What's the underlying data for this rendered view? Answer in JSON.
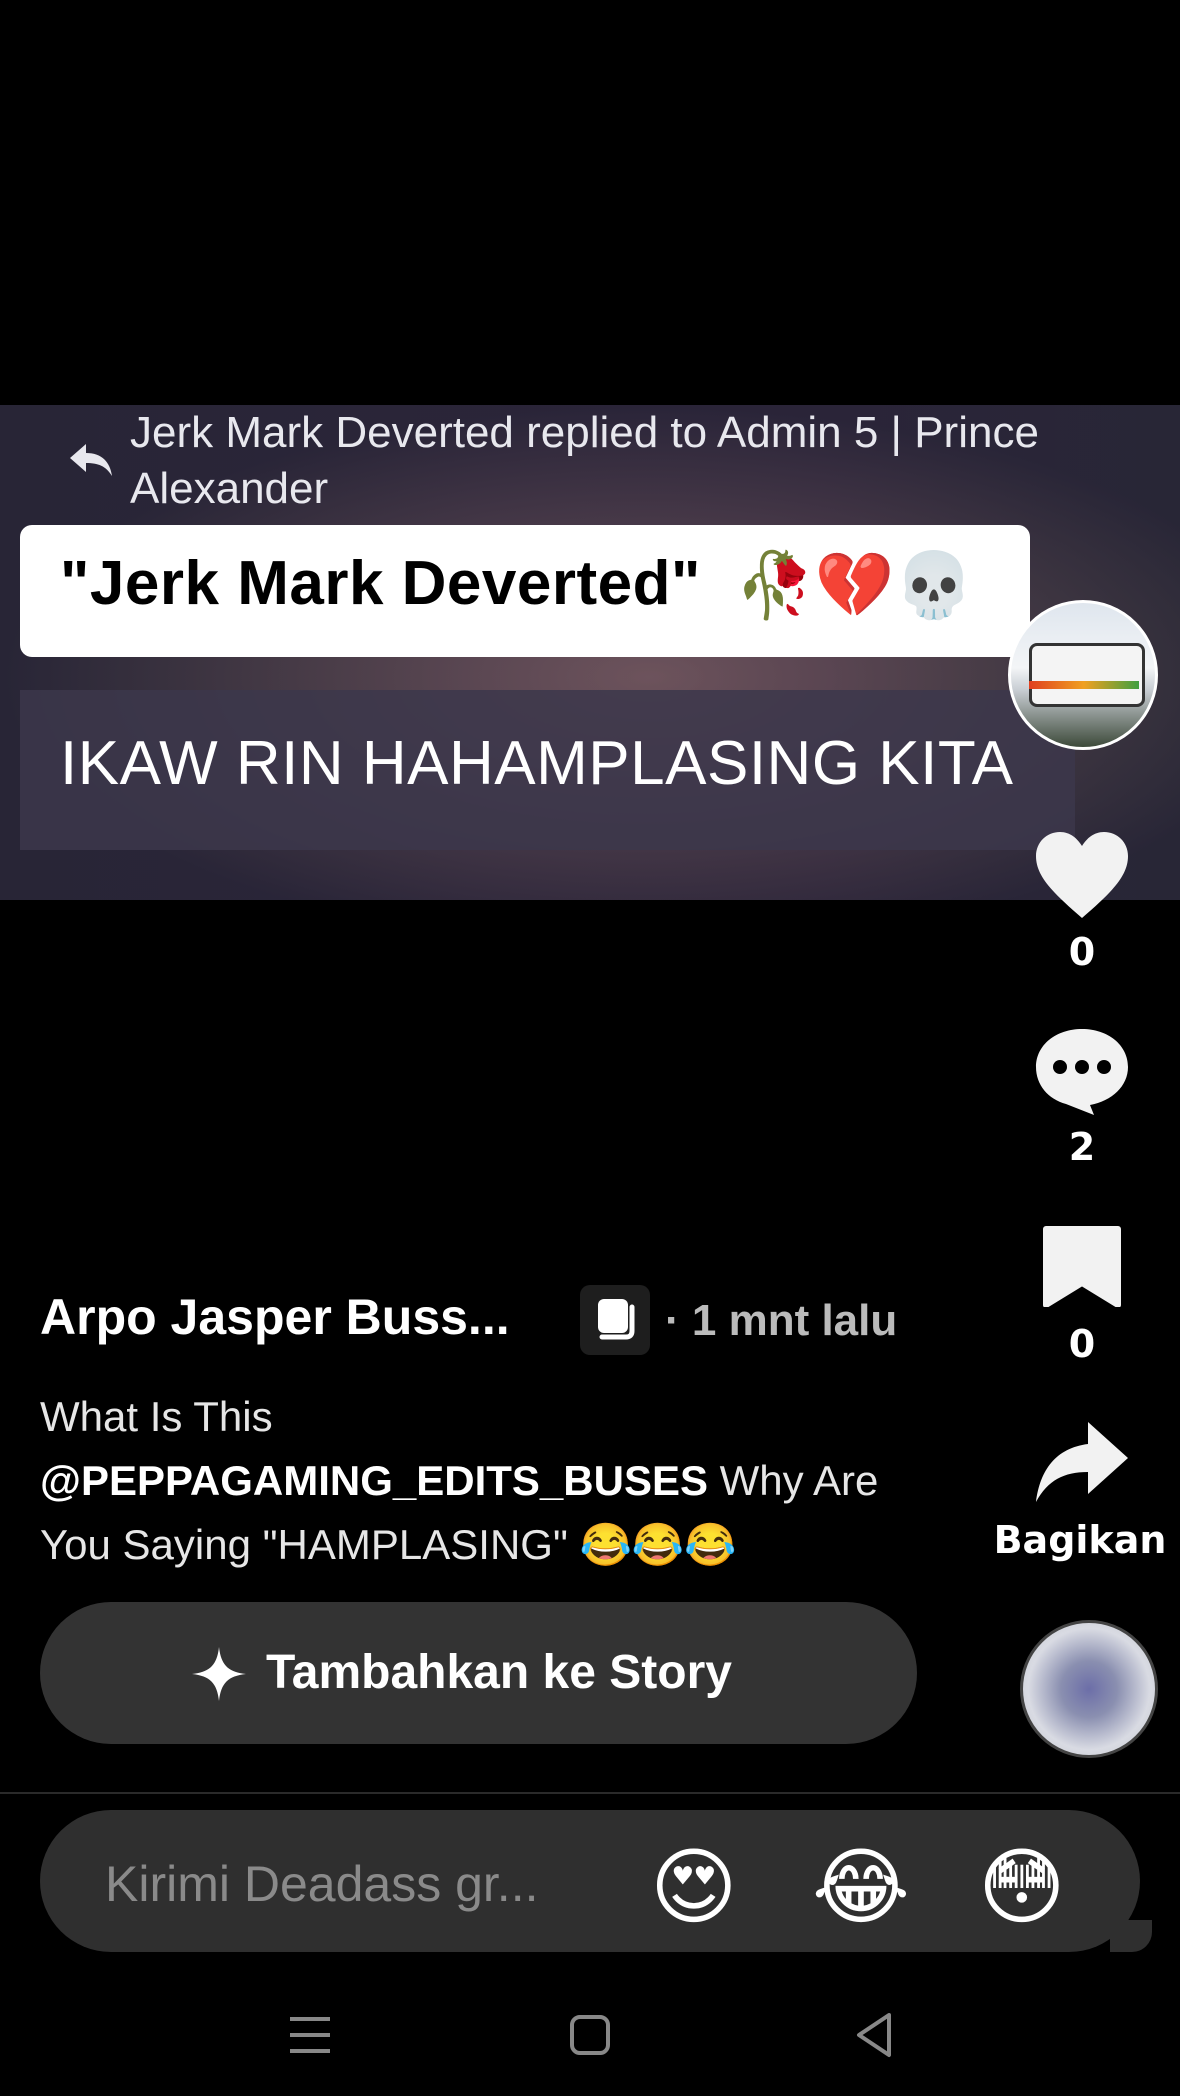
{
  "video": {
    "reply_header": "Jerk Mark Deverted replied to Admin 5 | Prince Alexander",
    "sticker_text": "\"Jerk Mark Deverted\"",
    "sticker_emojis": "🥀💔💀",
    "comment_text": "IKAW RIN HAHAMPLASING KITA"
  },
  "rail": {
    "likes": "0",
    "comments": "2",
    "saves": "0",
    "share_label": "Bagikan"
  },
  "post": {
    "author": "Arpo Jasper Buss...",
    "time": "· 1 mnt lalu",
    "caption_prefix": "What Is This",
    "caption_mention": "@PEPPAGAMING_EDITS_BUSES",
    "caption_suffix": " Why Are You Saying \"HAMPLASING\" 😂😂😂"
  },
  "story_button": {
    "label": "Tambahkan ke Story"
  },
  "message": {
    "placeholder": "Kirimi Deadass gr...",
    "quick_reactions": [
      "😍",
      "😂",
      "😳"
    ]
  },
  "colors": {
    "background": "#000000",
    "button_bg": "#333333",
    "field_bg": "#2f2f2f"
  }
}
